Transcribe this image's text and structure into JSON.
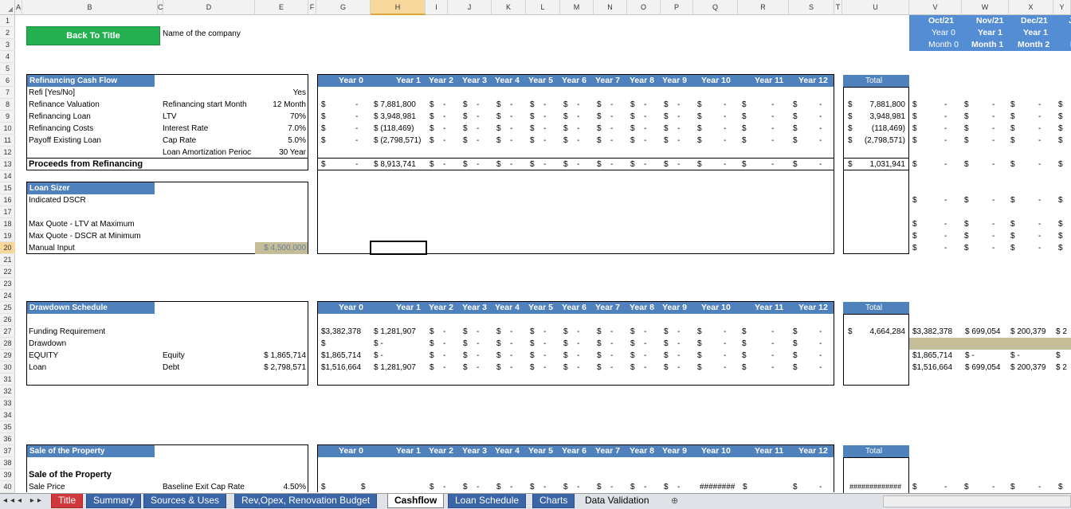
{
  "columns": [
    "A",
    "B",
    "C",
    "D",
    "E",
    "F",
    "G",
    "H",
    "I",
    "J",
    "K",
    "L",
    "M",
    "N",
    "O",
    "P",
    "Q",
    "R",
    "S",
    "T",
    "U",
    "V",
    "W",
    "X",
    "Y"
  ],
  "rows": [
    "1",
    "2",
    "3",
    "4",
    "5",
    "6",
    "7",
    "8",
    "9",
    "10",
    "11",
    "12",
    "13",
    "14",
    "15",
    "16",
    "17",
    "18",
    "19",
    "20",
    "21",
    "22",
    "23",
    "24",
    "25",
    "26",
    "27",
    "28",
    "29",
    "30",
    "31",
    "32",
    "33",
    "34",
    "35",
    "36",
    "37",
    "38",
    "39",
    "40"
  ],
  "back_button": "Back To Title",
  "company_label": "Name of the company",
  "timeline": {
    "months": [
      "Oct/21",
      "Nov/21",
      "Dec/21",
      "J"
    ],
    "years": [
      "Year 0",
      "Year 1",
      "Year 1",
      ""
    ],
    "month_nums": [
      "Month 0",
      "Month 1",
      "Month 2",
      "M"
    ]
  },
  "year_headers": [
    "Year 0",
    "Year 1",
    "Year 2",
    "Year 3",
    "Year 4",
    "Year 5",
    "Year 6",
    "Year 7",
    "Year 8",
    "Year 9",
    "Year 10",
    "Year 11",
    "Year 12"
  ],
  "total_label": "Total",
  "refi": {
    "title": "Refinancing Cash Flow",
    "labels": [
      "Refi [Yes/No]",
      "Refinance Valuation",
      "Refinancing Loan",
      "Refinancing Costs",
      "Payoff Existing Loan"
    ],
    "refi_value": "Yes",
    "params": [
      {
        "label": "Refinancing start Month",
        "value": "12 Month"
      },
      {
        "label": "LTV",
        "value": "70%"
      },
      {
        "label": "Interest Rate",
        "value": "7.0%"
      },
      {
        "label": "Cap Rate",
        "value": "5.0%"
      },
      {
        "label": "Loan Amortization Perioc",
        "value": "30 Year"
      }
    ],
    "proceeds_label": "Proceeds from Refinancing",
    "row_values": [
      {
        "y0": "$        -",
        "y1": "$ 7,881,800",
        "total": "7,881,800"
      },
      {
        "y0": "$        -",
        "y1": "$ 3,948,981",
        "total": "3,948,981"
      },
      {
        "y0": "$        -",
        "y1": "$   (118,469)",
        "total": "(118,469)"
      },
      {
        "y0": "$        -",
        "y1": "$ (2,798,571)",
        "total": "(2,798,571)"
      }
    ],
    "proceeds": {
      "y0": "$        -",
      "y1": "$ 8,913,741",
      "total": "1,031,941"
    }
  },
  "loan_sizer": {
    "title": "Loan Sizer",
    "labels": [
      "Indicated DSCR",
      "Max Quote - LTV at Maximum",
      "Max Quote - DSCR at Minimum",
      "Manual Input"
    ],
    "manual_value": "$ 4,500,000"
  },
  "drawdown": {
    "title": "Drawdown Schedule",
    "labels": [
      "Funding Requirement",
      "Drawdown",
      "EQUITY",
      "Loan"
    ],
    "sub": [
      {
        "label": "Equity",
        "value": "$ 1,865,714"
      },
      {
        "label": "Debt",
        "value": "$ 2,798,571"
      }
    ],
    "y0": [
      "$3,382,378",
      "$",
      "$1,865,714",
      "$1,516,664"
    ],
    "y1": [
      "$ 1,281,907",
      "$          -",
      "$          -",
      "$ 1,281,907"
    ],
    "total": "4,664,284",
    "monthly": [
      [
        "$3,382,378",
        "$ 699,054",
        "$ 200,379",
        "$ 2"
      ],
      [
        "",
        "",
        "",
        ""
      ],
      [
        "$1,865,714",
        "$        -",
        "$        -",
        "$"
      ],
      [
        "$1,516,664",
        "$ 699,054",
        "$ 200,379",
        "$ 2"
      ]
    ]
  },
  "sale": {
    "title": "Sale of the Property",
    "sub_title": "Sale of the Property",
    "sale_price_label": "Sale Price",
    "cap_label": "Baseline Exit Cap Rate",
    "cap_value": "4.50%",
    "overflow": "########",
    "total_overflow": "#############"
  },
  "tabs": [
    "Title",
    "Summary",
    "Sources & Uses",
    "Rev,Opex, Renovation Budget",
    "Cashflow",
    "Loan Schedule",
    "Charts",
    "Data Validation"
  ],
  "active_tab": "Cashflow"
}
